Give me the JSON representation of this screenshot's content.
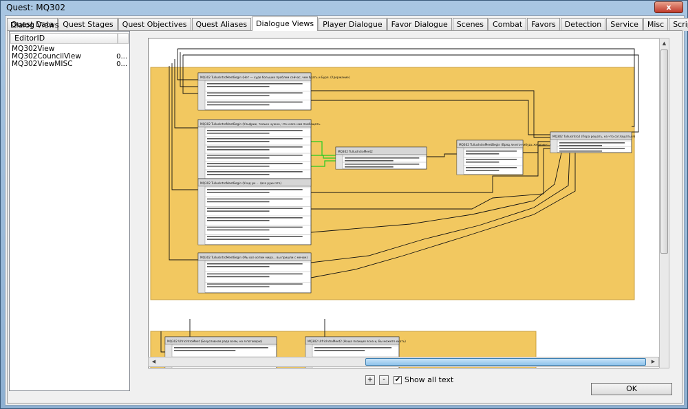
{
  "window": {
    "title": "Quest: MQ302",
    "close_label": "x"
  },
  "tabs": [
    "Quest Data",
    "Quest Stages",
    "Quest Objectives",
    "Quest Aliases",
    "Dialogue Views",
    "Player Dialogue",
    "Favor Dialogue",
    "Scenes",
    "Combat",
    "Favors",
    "Detection",
    "Service",
    "Misc",
    "Scripts"
  ],
  "active_tab": "Dialogue Views",
  "dialog_views": {
    "label": "Dialog Views",
    "column_header": "EditorID",
    "items": [
      {
        "id": "MQ302View",
        "value": ""
      },
      {
        "id": "MQ302CouncilView",
        "value": "0..."
      },
      {
        "id": "MQ302ViewMISC",
        "value": "0..."
      }
    ]
  },
  "controls": {
    "zoom_in": "+",
    "zoom_out": "-",
    "show_all_text": "Show all text",
    "show_all_text_checked": true,
    "ok": "OK"
  },
  "colors": {
    "view_bg": "#f2c860",
    "node_bg": "#ffffff",
    "node_header": "#d6d6d6",
    "selected_link": "#22cc22"
  },
  "nodes": [
    {
      "title": "MQ302 TullusIntroMeetBegin (Нет — худе больших проблем сейчас, чем брать и Буря. (Удержание)"
    },
    {
      "title": "MQ302 TullusIntroMeetBegin (Ульфрик, только нужно, что и все нам пообещать."
    },
    {
      "title": "MQ302 TullusIntroMeet2"
    },
    {
      "title": "MQ302 TullusIntroMeetBegin (Вряд ли кто-нибудь же может продать ваших"
    },
    {
      "title": "MQ302 TullusIntro2 (Пора решать, на что соглашаться)"
    },
    {
      "title": "MQ302 TullusIntroMeetBegin (Уход ум ... (все руки это)"
    },
    {
      "title": "MQ302 TullusIntroMeetBegin (Мы все хотим мира... вы пришли с мечом)"
    },
    {
      "title": "MQ302 UlfricIntroMeet (Безусловная рада всем, но я поговорю)"
    },
    {
      "title": "MQ302 UlfricIntroMeet2 (Наша позиция ясна и, Вы можете ехать)"
    }
  ]
}
